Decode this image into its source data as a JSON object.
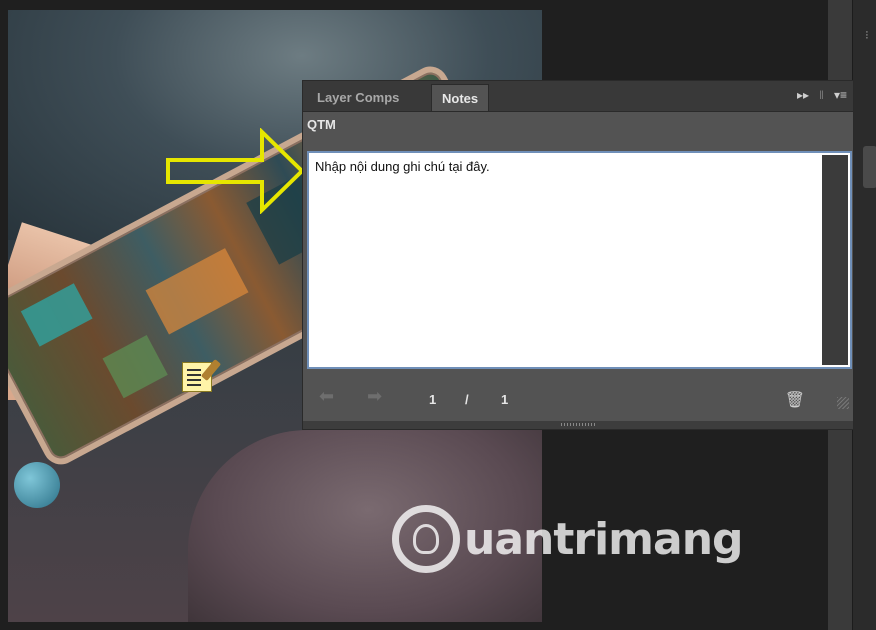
{
  "panel": {
    "tabs": [
      {
        "label": "Layer Comps",
        "active": false
      },
      {
        "label": "Notes",
        "active": true
      }
    ],
    "author": "QTM",
    "note_text": "Nhập nội dung ghi chú tại đây.",
    "page_current": "1",
    "page_separator": "/",
    "page_total": "1"
  },
  "watermark": {
    "text": "uantrimang"
  },
  "icons": {
    "collapse": "double-chevron-right-icon",
    "menu": "panel-menu-icon",
    "prev": "arrow-left-icon",
    "next": "arrow-right-icon",
    "delete": "trash-icon",
    "note": "note-annotation-icon",
    "callout": "yellow-arrow-icon"
  },
  "colors": {
    "panel_bg": "#535353",
    "tab_bar_bg": "#393939",
    "text_field_border": "#6f8fb8",
    "arrow_outline": "#e6e600"
  }
}
